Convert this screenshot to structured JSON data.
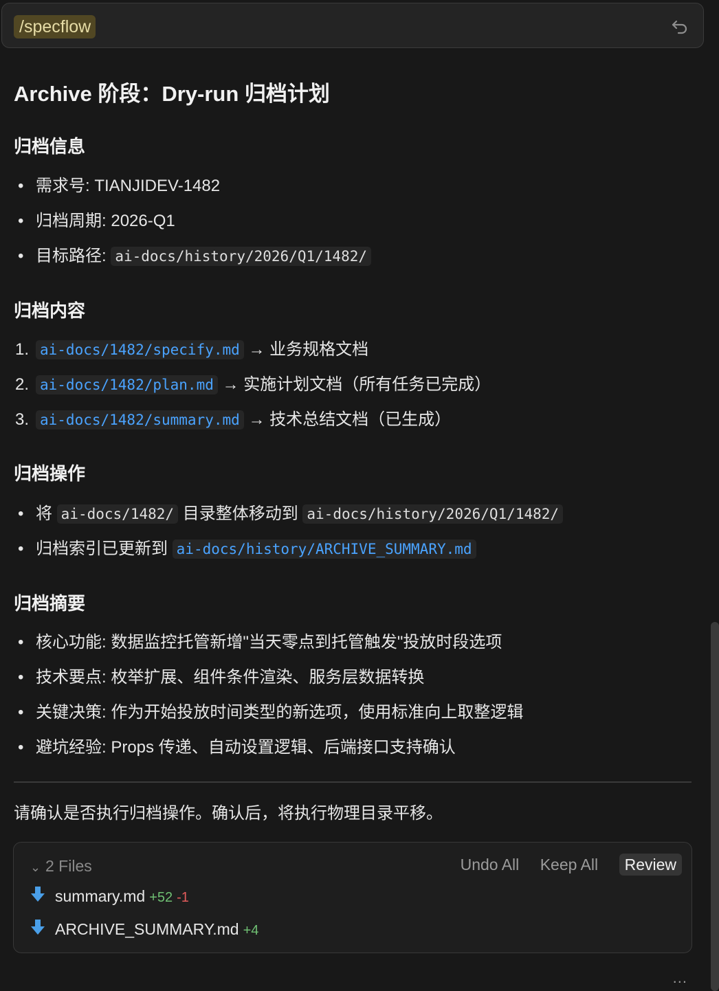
{
  "command": {
    "chip": "/specflow"
  },
  "title": "Archive 阶段：Dry-run 归档计划",
  "sections": {
    "info": {
      "heading": "归档信息",
      "items": [
        {
          "label": "需求号: ",
          "value": "TIANJIDEV-1482"
        },
        {
          "label": "归档周期: ",
          "value": "2026-Q1"
        },
        {
          "label": "目标路径: ",
          "code": "ai-docs/history/2026/Q1/1482/"
        }
      ]
    },
    "content": {
      "heading": "归档内容",
      "items": [
        {
          "num": "1.",
          "path": "ai-docs/1482/specify.md",
          "desc": " → 业务规格文档"
        },
        {
          "num": "2.",
          "path": "ai-docs/1482/plan.md",
          "desc": " → 实施计划文档（所有任务已完成）"
        },
        {
          "num": "3.",
          "path": "ai-docs/1482/summary.md",
          "desc": " → 技术总结文档（已生成）"
        }
      ]
    },
    "ops": {
      "heading": "归档操作",
      "item1": {
        "pre": "将 ",
        "src": "ai-docs/1482/",
        "mid": " 目录整体移动到 ",
        "dst": "ai-docs/history/2026/Q1/1482/"
      },
      "item2": {
        "pre": "归档索引已更新到 ",
        "link": "ai-docs/history/ARCHIVE_SUMMARY.md"
      }
    },
    "summary": {
      "heading": "归档摘要",
      "items": [
        "核心功能: 数据监控托管新增\"当天零点到托管触发\"投放时段选项",
        "技术要点: 枚举扩展、组件条件渲染、服务层数据转换",
        "关键决策: 作为开始投放时间类型的新选项，使用标准向上取整逻辑",
        "避坑经验: Props 传递、自动设置逻辑、后端接口支持确认"
      ]
    }
  },
  "confirm_text": "请确认是否执行归档操作。确认后，将执行物理目录平移。",
  "files_panel": {
    "count_label": "2 Files",
    "actions": {
      "undo_all": "Undo All",
      "keep_all": "Keep All",
      "review": "Review"
    },
    "files": [
      {
        "name": "summary.md",
        "added": "+52",
        "removed": "-1"
      },
      {
        "name": "ARCHIVE_SUMMARY.md",
        "added": "+4"
      }
    ]
  },
  "more": "...",
  "colors": {
    "background": "#181818",
    "link": "#4aa3ff",
    "chip_bg": "#514723",
    "added": "#6fbf73",
    "removed": "#e25b5b"
  },
  "icons": {
    "undo": "undo-icon",
    "collapse": "chevron-down-icon",
    "file": "markdown-file-icon",
    "more": "more-icon"
  }
}
